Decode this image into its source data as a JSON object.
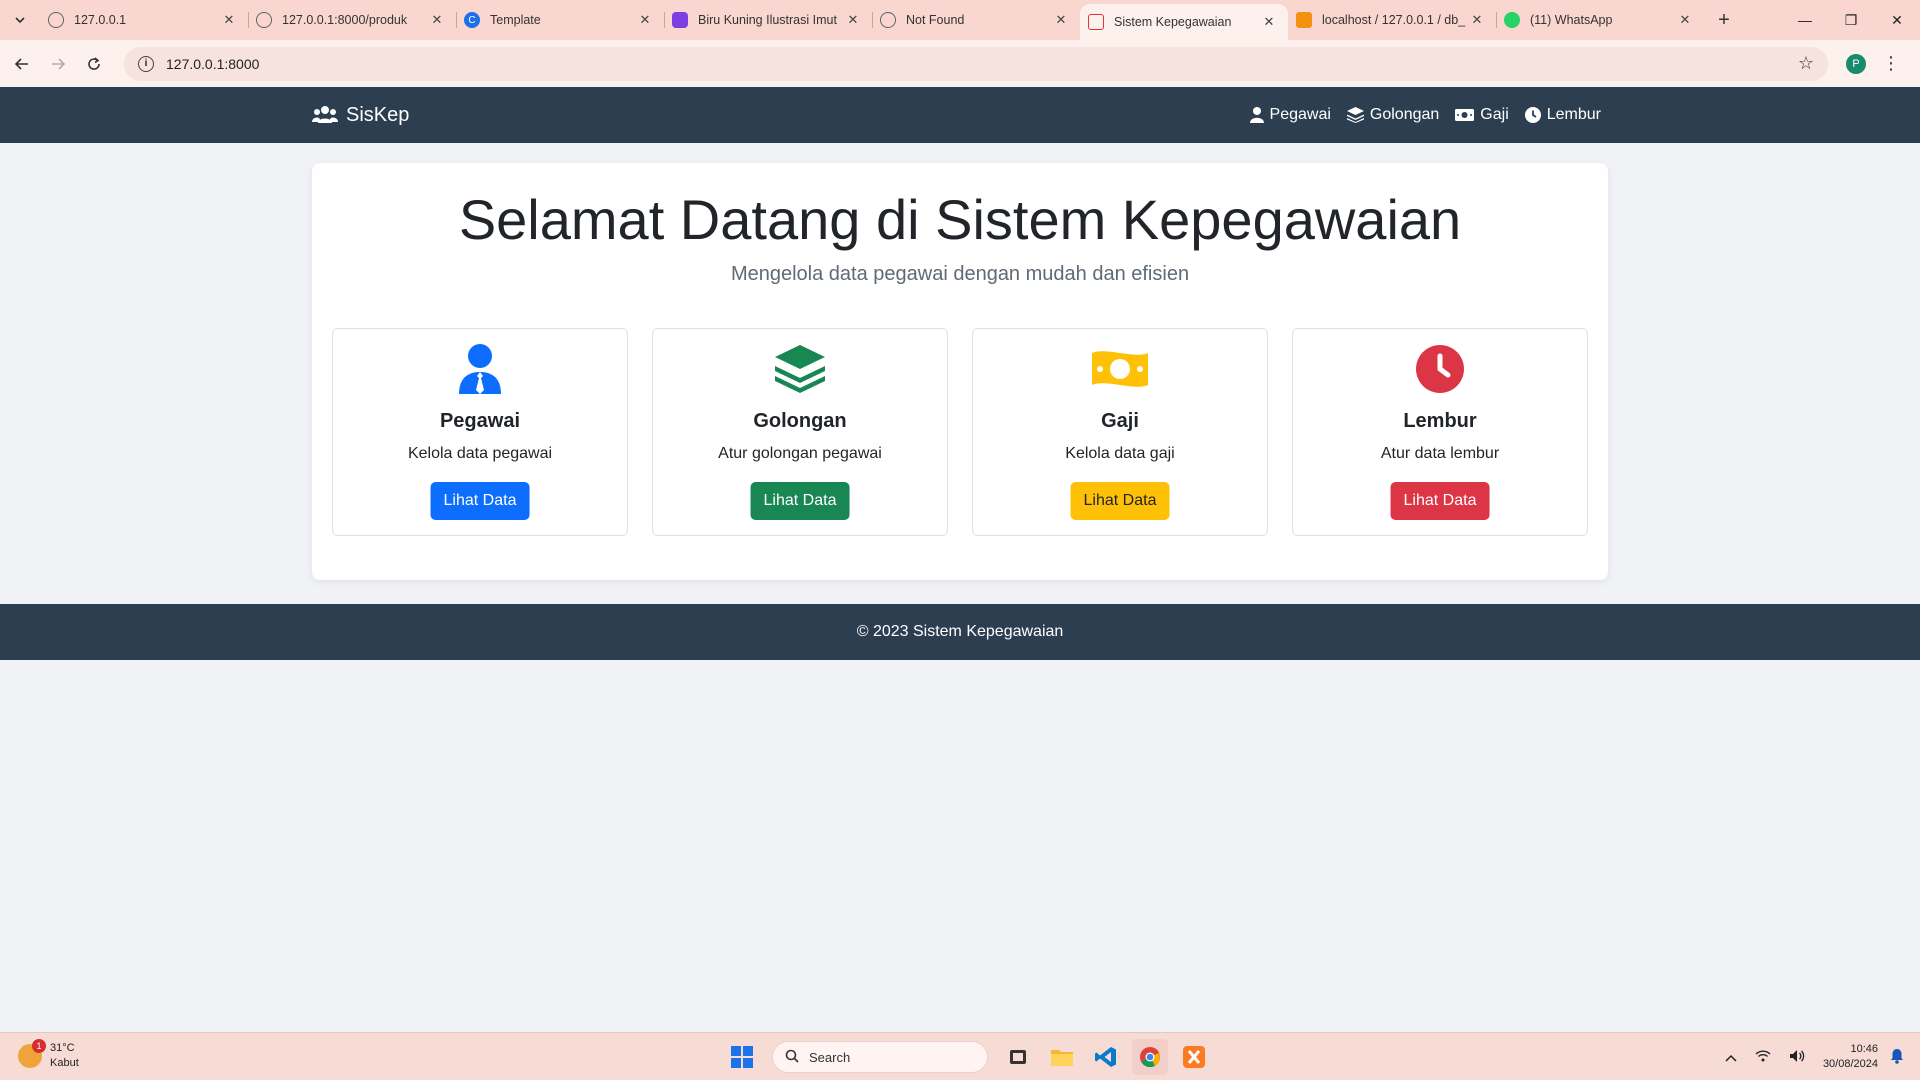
{
  "browser": {
    "tabs": [
      {
        "title": "127.0.0.1",
        "favicon": "globe-icon",
        "color": "#5f6368"
      },
      {
        "title": "127.0.0.1:8000/produk",
        "favicon": "globe-icon",
        "color": "#5f6368"
      },
      {
        "title": "Template",
        "favicon": "template-icon",
        "color": "#1f6feb"
      },
      {
        "title": "Biru Kuning Ilustrasi Imut",
        "favicon": "canva-icon",
        "color": "#7b3fe4"
      },
      {
        "title": "Not Found",
        "favicon": "globe-icon",
        "color": "#5f6368"
      },
      {
        "title": "Sistem Kepegawaian",
        "favicon": "laravel-icon",
        "color": "#e3342f"
      },
      {
        "title": "localhost / 127.0.0.1 / db_",
        "favicon": "phpmyadmin-icon",
        "color": "#f29111"
      },
      {
        "title": "(11) WhatsApp",
        "favicon": "whatsapp-icon",
        "color": "#25d366"
      }
    ],
    "url": "127.0.0.1:8000",
    "profile_initial": "P"
  },
  "navbar": {
    "brand": "SisKep",
    "links": [
      {
        "label": "Pegawai",
        "icon": "user-icon"
      },
      {
        "label": "Golongan",
        "icon": "layers-icon"
      },
      {
        "label": "Gaji",
        "icon": "money-icon"
      },
      {
        "label": "Lembur",
        "icon": "clock-icon"
      }
    ]
  },
  "hero": {
    "title": "Selamat Datang di Sistem Kepegawaian",
    "subtitle": "Mengelola data pegawai dengan mudah dan efisien"
  },
  "features": [
    {
      "title": "Pegawai",
      "description": "Kelola data pegawai",
      "button": "Lihat Data",
      "color": "#0d6efd",
      "icon": "user-tie-icon"
    },
    {
      "title": "Golongan",
      "description": "Atur golongan pegawai",
      "button": "Lihat Data",
      "color": "#198754",
      "icon": "layers-icon"
    },
    {
      "title": "Gaji",
      "description": "Kelola data gaji",
      "button": "Lihat Data",
      "color": "#ffc107",
      "icon": "money-icon"
    },
    {
      "title": "Lembur",
      "description": "Atur data lembur",
      "button": "Lihat Data",
      "color": "#dc3545",
      "icon": "clock-icon"
    }
  ],
  "footer": {
    "text": "© 2023 Sistem Kepegawaian"
  },
  "taskbar": {
    "weather_temp": "31°C",
    "weather_desc": "Kabut",
    "weather_badge": "1",
    "search_placeholder": "Search",
    "time": "10:46",
    "date": "30/08/2024"
  }
}
